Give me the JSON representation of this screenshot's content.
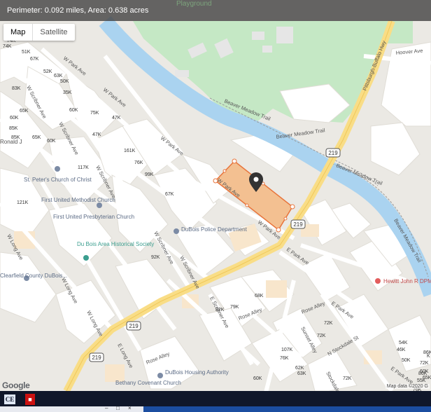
{
  "header": {
    "measure_text": "Perimeter: 0.092 miles, Area: 0.638 acres",
    "top_label": "Playground"
  },
  "map_type": {
    "map_label": "Map",
    "satellite_label": "Satellite",
    "selected": "Map"
  },
  "footer": {
    "logo": "Google",
    "attribution": "Map data ©2020 G"
  },
  "colors": {
    "park": "#c5e8c5",
    "water": "#aad3f0",
    "highway": "#f9dd86",
    "parcel_fill": "#f5b883",
    "parcel_stroke": "#e8743b",
    "block": "#ffffff",
    "street": "#ebe9e4"
  },
  "taskbar": {
    "app1": "CE",
    "app2": "PDF",
    "app1_icon": "ce-app-icon",
    "app2_icon": "pdf-app-icon"
  },
  "street_labels": [
    "W Park Ave",
    "W Park Ave",
    "W Park Ave",
    "W Park Ave",
    "W Park Ave",
    "W Scribner Ave",
    "W Scribner Ave",
    "W Scribner Ave",
    "W Scribner Ave",
    "W Scribner Ave",
    "W Long Ave",
    "W Long Ave",
    "W Long Ave",
    "Pittsburgh-Buffalo Hwy",
    "Beaver Meadow Trail",
    "Beaver Meadow Trail",
    "Beaver Meadow Trail",
    "Beaver Meadow Trail",
    "Hoover Ave",
    "E Park Ave",
    "E Park Ave",
    "E Scribner Ave",
    "Rose Alley",
    "Rose Alley",
    "Rose Alley",
    "E Long Ave",
    "Sunset Alley",
    "N Stockdale St",
    "E Park Ave",
    "Stockdale"
  ],
  "pois": [
    {
      "name": "St. Peter's Church of Christ",
      "icon": "church-icon"
    },
    {
      "name": "First United Methodist Church",
      "icon": "church-icon"
    },
    {
      "name": "First United Presbyterian Church",
      "icon": "church-icon"
    },
    {
      "name": "DuBois Police Department",
      "icon": "police-icon"
    },
    {
      "name": "Du Bois Area Historical Society",
      "icon": "museum-icon"
    },
    {
      "name": "Clearfield County DuBois...",
      "icon": "government-icon"
    },
    {
      "name": "DuBois Housing Authority",
      "icon": "building-icon"
    },
    {
      "name": "Bethany Covenant Church",
      "icon": "church-icon"
    },
    {
      "name": "Hewitt John R DPM",
      "icon": "medical-icon"
    },
    {
      "name": "Ronald J",
      "icon": "place-icon"
    }
  ],
  "route_shields": [
    "219",
    "219",
    "219",
    "219"
  ],
  "price_labels": [
    "74K",
    "74K",
    "51K",
    "67K",
    "52K",
    "63K",
    "50K",
    "35K",
    "83K",
    "60K",
    "65K",
    "60K",
    "75K",
    "47K",
    "47K",
    "85K",
    "85K",
    "65K",
    "60K",
    "161K",
    "76K",
    "99K",
    "117K",
    "67K",
    "121K",
    "92K",
    "68K",
    "79K",
    "82K",
    "72K",
    "72K",
    "107K",
    "76K",
    "62K",
    "63K",
    "60K",
    "54K",
    "46K",
    "50K",
    "72K",
    "72K",
    "55K",
    "76K",
    "86K",
    "86K",
    "60K",
    "65K",
    "K"
  ]
}
